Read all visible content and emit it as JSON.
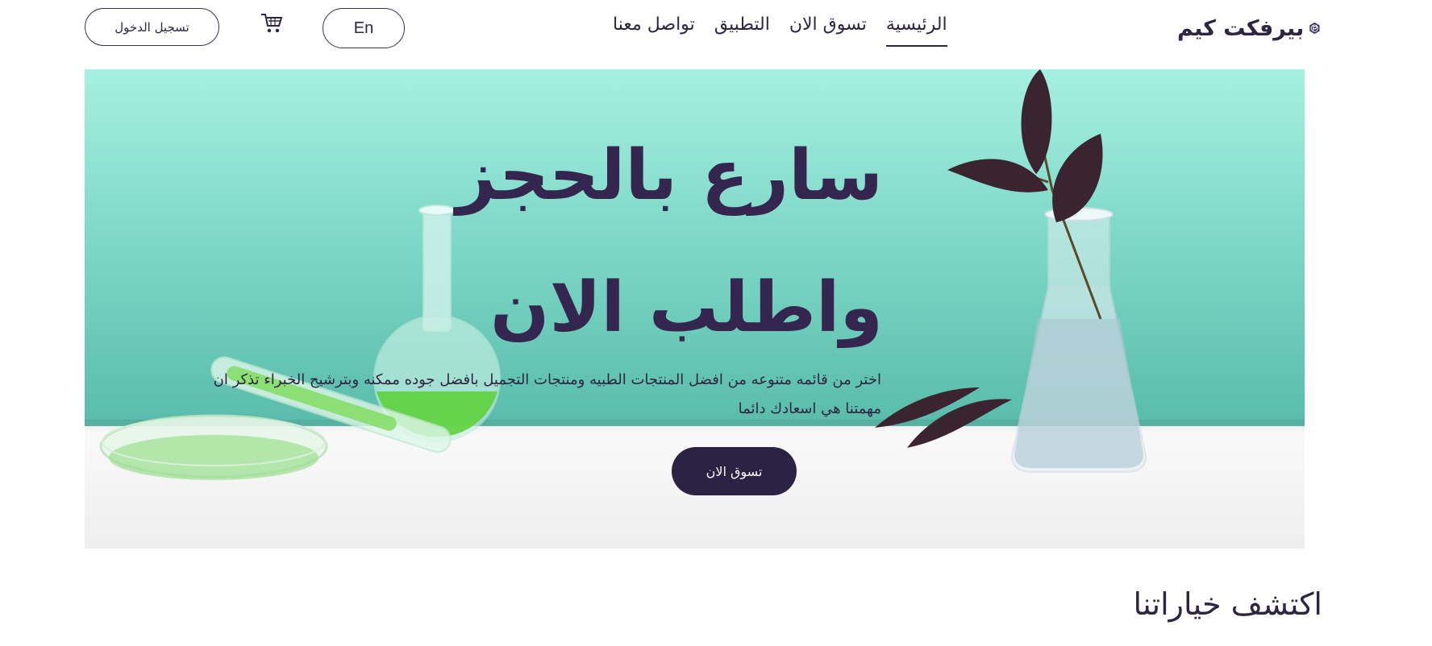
{
  "header": {
    "login_label": "تسجيل الدخول",
    "lang_label": "En",
    "cart_icon": "cart-icon",
    "nav": [
      {
        "label": "الرئيسية",
        "active": true
      },
      {
        "label": "تسوق الان",
        "active": false
      },
      {
        "label": "التطبيق",
        "active": false
      },
      {
        "label": "تواصل معنا",
        "active": false
      }
    ],
    "logo_text": "بيرفكت كيم",
    "logo_icon": "p-logo-icon"
  },
  "hero": {
    "title": "سارع بالحجز واطلب الان",
    "description": "اختر من قائمه متنوعه من افضل المنتجات الطبيه ومنتجات التجميل بافضل جوده ممكنه وبترشيح الخبراء تذكر ان مهمتنا هي اسعادك دائما",
    "button_label": "تسوق الان"
  },
  "section": {
    "title": "اكتشف خياراتنا"
  },
  "colors": {
    "primary": "#2c2244",
    "text": "#2e2540",
    "hero_bg": "#7fd8c7"
  }
}
